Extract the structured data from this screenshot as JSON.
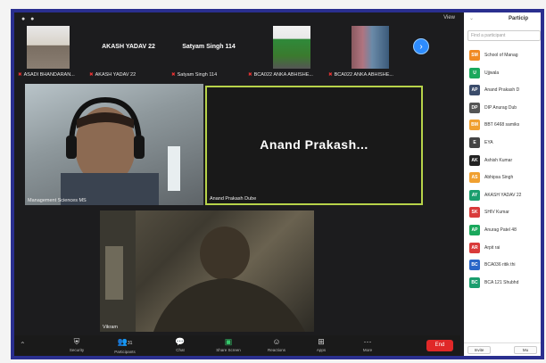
{
  "topbar": {
    "view_label": "View"
  },
  "filmstrip": {
    "thumbs": [
      {
        "label": "ASADI BHANDARAN..."
      },
      {
        "label": "AKASH YADAV 22",
        "display_name": "AKASH YADAV 22"
      },
      {
        "label": "Satyam Singh 114",
        "display_name": "Satyam Singh 114"
      },
      {
        "label": "BCA022 ANKA ABHISHE..."
      },
      {
        "label": "BCA022 ANKA ABHISHE..."
      }
    ]
  },
  "tiles": {
    "t1_label": "Management Sciences MS",
    "t2_name": "Anand Prakash...",
    "t2_label": "Anand Prakash Dube",
    "t3_label": "Vikram"
  },
  "toolbar": {
    "items": [
      {
        "icon": "shield-icon",
        "label": "Security"
      },
      {
        "icon": "participants-icon",
        "label": "Participants",
        "count": "31"
      },
      {
        "icon": "chat-icon",
        "label": "Chat"
      },
      {
        "icon": "share-screen-icon",
        "label": "Share Screen"
      },
      {
        "icon": "reactions-icon",
        "label": "Reactions"
      },
      {
        "icon": "apps-icon",
        "label": "Apps"
      },
      {
        "icon": "more-icon",
        "label": "More"
      }
    ],
    "end_label": "End"
  },
  "panel": {
    "title": "Particip",
    "search_placeholder": "Find a participant",
    "participants": [
      {
        "initials": "SM",
        "name": "School of Manag",
        "color": "#f08a24"
      },
      {
        "initials": "U",
        "name": "Ujjwala",
        "color": "#1aa85c"
      },
      {
        "initials": "AP",
        "name": "Anand Prakash D",
        "color": "#3b4c6b"
      },
      {
        "initials": "DP",
        "name": "DIP Anurag Dub",
        "color": "#555555"
      },
      {
        "initials": "BM",
        "name": "BBT 6468 samiks",
        "color": "#f0a030"
      },
      {
        "initials": "E",
        "name": "EYA",
        "color": "#444444"
      },
      {
        "initials": "AK",
        "name": "Ashish Kumar",
        "color": "#222222"
      },
      {
        "initials": "AS",
        "name": "Abhipsa Singh",
        "color": "#f0a030"
      },
      {
        "initials": "AY",
        "name": "AKASH YADAV 22",
        "color": "#1a9e6e"
      },
      {
        "initials": "SK",
        "name": "SHIV Kumar",
        "color": "#d93b3b"
      },
      {
        "initials": "AP",
        "name": "Anurag Patel 48",
        "color": "#1aa85c"
      },
      {
        "initials": "AR",
        "name": "Arpit rai",
        "color": "#d93b3b"
      },
      {
        "initials": "BC",
        "name": "BCA036 ritik thi",
        "color": "#2a66c8"
      },
      {
        "initials": "BC",
        "name": "BCA 121 Shubhd",
        "color": "#1a9e6e"
      }
    ],
    "footer_buttons": [
      "Invite",
      "Mu"
    ]
  }
}
